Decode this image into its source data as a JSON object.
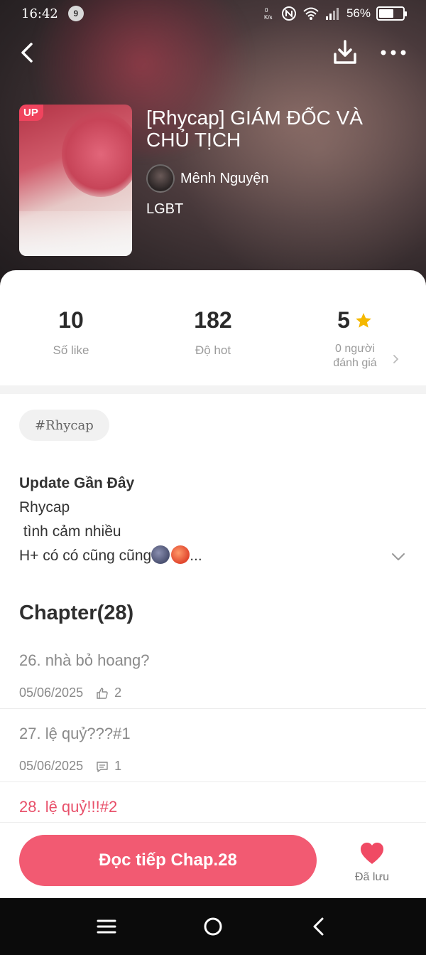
{
  "status_bar": {
    "time": "16:42",
    "notification_count": "9",
    "speed": "0 K/s",
    "battery_percent": "56%",
    "battery_level": 0.56
  },
  "story": {
    "cover_badge": "UP",
    "title": "[Rhycap] GIÁM ĐỐC VÀ CHỦ TỊCH",
    "author": "Mênh Nguyện",
    "genre": "LGBT"
  },
  "stats": {
    "likes_value": "10",
    "likes_label": "Số like",
    "hot_value": "182",
    "hot_label": "Độ hot",
    "rating_value": "5",
    "rating_label_line1": "0 người",
    "rating_label_line2": "đánh giá"
  },
  "tags": [
    "#Rhycap"
  ],
  "description": {
    "heading": "Update Gần Đây",
    "line1": "Rhycap",
    "line2": " tình cảm nhiều",
    "line3_text": "H+ có có cũng cũng",
    "line3_suffix": "..."
  },
  "chapters": {
    "heading": "Chapter(28)",
    "items": [
      {
        "title": "26. nhà bỏ hoang?",
        "date": "05/06/2025",
        "count": "2",
        "icon": "thumbs-up-icon"
      },
      {
        "title": "27. lệ quỷ???#1",
        "date": "05/06/2025",
        "count": "1",
        "icon": "comment-icon"
      },
      {
        "title": "28. lệ quỷ!!!#2",
        "date": "",
        "count": "",
        "icon": ""
      }
    ]
  },
  "actions": {
    "read_button": "Đọc tiếp Chap.28",
    "saved_label": "Đã lưu"
  },
  "colors": {
    "accent": "#f25a72",
    "badge": "#f0445e",
    "star": "#f5b800"
  }
}
